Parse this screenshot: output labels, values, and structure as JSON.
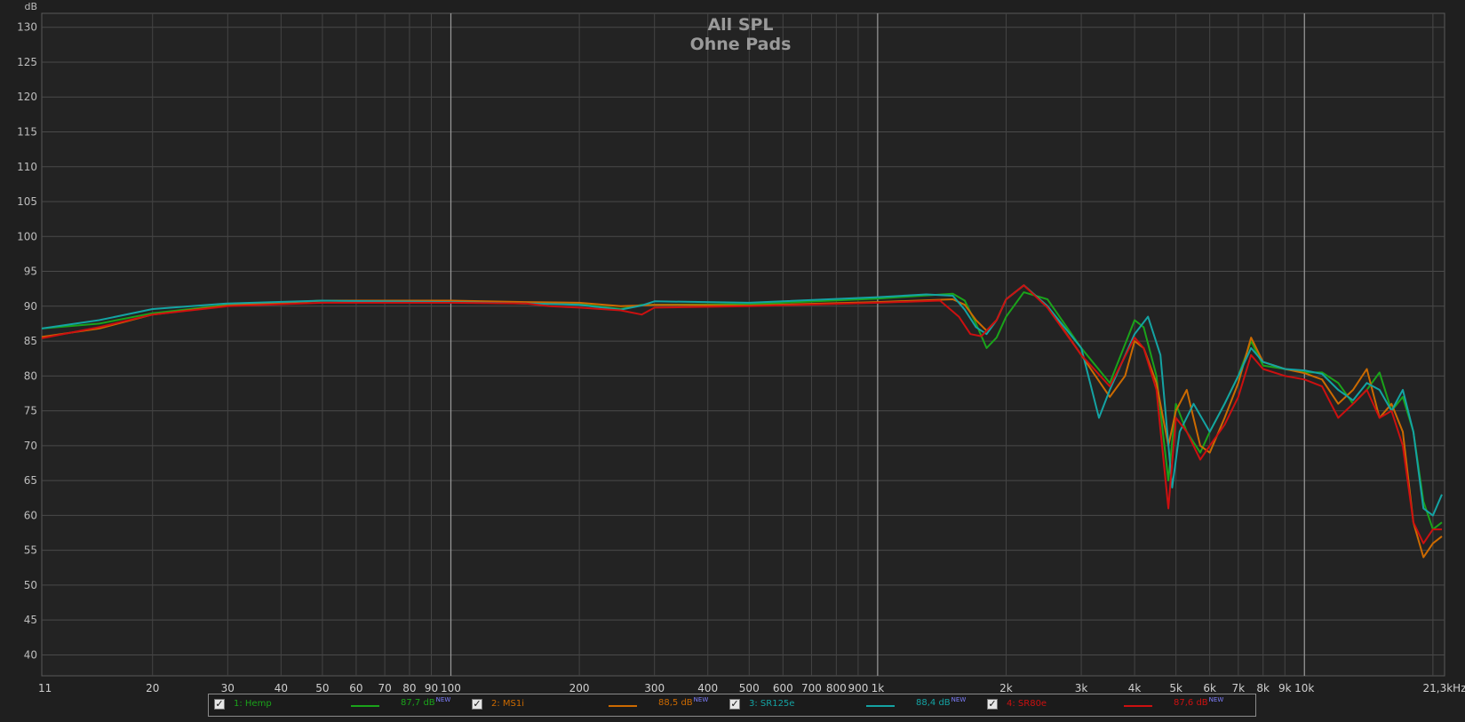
{
  "chart_data": {
    "type": "line",
    "title": "All SPL",
    "subtitle": "Ohne Pads",
    "ylabel": "dB",
    "xscale": "log",
    "xlim": [
      11,
      21300
    ],
    "ylim": [
      37,
      132
    ],
    "grid": true,
    "y_ticks": [
      130,
      125,
      120,
      115,
      110,
      105,
      100,
      95,
      90,
      85,
      80,
      75,
      70,
      65,
      60,
      55,
      50,
      45,
      40
    ],
    "x_ticks": [
      {
        "v": 11,
        "label": "11"
      },
      {
        "v": 20,
        "label": "20"
      },
      {
        "v": 30,
        "label": "30"
      },
      {
        "v": 40,
        "label": "40"
      },
      {
        "v": 50,
        "label": "50"
      },
      {
        "v": 60,
        "label": "60"
      },
      {
        "v": 70,
        "label": "70"
      },
      {
        "v": 80,
        "label": "80"
      },
      {
        "v": 90,
        "label": "90"
      },
      {
        "v": 100,
        "label": "100"
      },
      {
        "v": 200,
        "label": "200"
      },
      {
        "v": 300,
        "label": "300"
      },
      {
        "v": 400,
        "label": "400"
      },
      {
        "v": 500,
        "label": "500"
      },
      {
        "v": 600,
        "label": "600"
      },
      {
        "v": 700,
        "label": "700"
      },
      {
        "v": 800,
        "label": "800"
      },
      {
        "v": 900,
        "label": "900"
      },
      {
        "v": 1000,
        "label": "1k"
      },
      {
        "v": 2000,
        "label": "2k"
      },
      {
        "v": 3000,
        "label": "3k"
      },
      {
        "v": 4000,
        "label": "4k"
      },
      {
        "v": 5000,
        "label": "5k"
      },
      {
        "v": 6000,
        "label": "6k"
      },
      {
        "v": 7000,
        "label": "7k"
      },
      {
        "v": 8000,
        "label": "8k"
      },
      {
        "v": 9000,
        "label": "9k"
      },
      {
        "v": 10000,
        "label": "10k"
      },
      {
        "v": 21300,
        "label": "21,3kHz"
      }
    ],
    "major_x_lines": [
      100,
      1000,
      10000
    ],
    "series": [
      {
        "name": "1: Hemp",
        "color": "#1aa31a",
        "level": "87,7 dB",
        "x": [
          11,
          15,
          20,
          30,
          50,
          100,
          150,
          200,
          250,
          280,
          300,
          500,
          1000,
          1500,
          1600,
          1700,
          1800,
          1900,
          2000,
          2200,
          2500,
          3000,
          3500,
          4000,
          4200,
          4500,
          4800,
          5000,
          5300,
          5700,
          6000,
          6500,
          7000,
          7500,
          8000,
          9000,
          10000,
          11000,
          12000,
          13000,
          14000,
          15000,
          16000,
          17000,
          18000,
          19000,
          20000,
          21000
        ],
        "y": [
          86.8,
          87.5,
          89,
          90.2,
          90.8,
          90.6,
          90.4,
          90.3,
          89.6,
          90.2,
          90.2,
          90.3,
          91.1,
          91.8,
          90.8,
          87.5,
          84,
          85.5,
          88.5,
          92,
          91,
          84,
          79,
          88,
          87,
          80,
          65,
          76,
          72,
          69,
          72,
          76,
          80,
          85,
          81.5,
          81,
          80.5,
          80.5,
          79,
          76,
          78,
          80.5,
          75,
          77,
          72,
          62,
          58,
          59
        ]
      },
      {
        "name": "2: MS1i",
        "color": "#cc6a00",
        "level": "88,5 dB",
        "x": [
          11,
          15,
          20,
          30,
          50,
          100,
          150,
          200,
          250,
          280,
          300,
          500,
          1000,
          1500,
          1600,
          1700,
          1800,
          1900,
          2000,
          2200,
          2500,
          3000,
          3500,
          3800,
          4000,
          4200,
          4500,
          4800,
          5000,
          5300,
          5700,
          6000,
          6500,
          7000,
          7500,
          8000,
          9000,
          10000,
          11000,
          12000,
          13000,
          14000,
          15000,
          16000,
          17000,
          18000,
          19000,
          20000,
          21000
        ],
        "y": [
          85.6,
          86.8,
          88.8,
          90.1,
          90.8,
          90.8,
          90.6,
          90.5,
          90,
          90.1,
          90.2,
          90.1,
          90.6,
          91,
          90.2,
          88,
          86.5,
          88,
          91,
          93,
          90,
          83,
          77,
          80,
          85,
          84,
          79,
          70,
          75,
          78,
          70,
          69,
          74,
          79,
          85.5,
          82,
          81,
          80.4,
          79.5,
          76,
          78,
          81,
          74,
          76,
          72,
          59,
          54,
          56,
          57
        ]
      },
      {
        "name": "3: SR125e",
        "color": "#14a3a3",
        "level": "88,4 dB",
        "x": [
          11,
          15,
          20,
          30,
          50,
          100,
          150,
          200,
          250,
          280,
          300,
          500,
          1000,
          1300,
          1500,
          1600,
          1700,
          1800,
          1900,
          2000,
          2200,
          2500,
          3000,
          3300,
          3500,
          4000,
          4300,
          4600,
          4900,
          5100,
          5500,
          6000,
          6500,
          7000,
          7500,
          8000,
          9000,
          10000,
          11000,
          12000,
          13000,
          14000,
          15000,
          16000,
          17000,
          18000,
          19000,
          20000,
          21000
        ],
        "y": [
          86.8,
          88,
          89.6,
          90.4,
          90.8,
          90.6,
          90.4,
          90.2,
          89.5,
          90.1,
          90.7,
          90.5,
          91.3,
          91.7,
          91.5,
          89.5,
          87,
          86,
          88,
          91,
          93,
          90,
          84,
          74,
          78,
          86,
          88.5,
          83,
          64,
          72,
          76,
          72,
          76,
          80,
          84,
          82,
          81,
          80.8,
          80.3,
          78,
          76.5,
          79,
          78,
          75,
          78,
          72,
          61,
          60,
          63
        ]
      },
      {
        "name": "4: SR80e",
        "color": "#cc1010",
        "level": "87,6 dB",
        "x": [
          11,
          15,
          20,
          30,
          50,
          100,
          150,
          170,
          200,
          250,
          280,
          300,
          500,
          1000,
          1400,
          1550,
          1650,
          1750,
          1900,
          2000,
          2200,
          2500,
          3000,
          3500,
          4000,
          4200,
          4500,
          4800,
          5000,
          5300,
          5700,
          6000,
          6500,
          7000,
          7500,
          8000,
          9000,
          10000,
          11000,
          12000,
          13000,
          14000,
          15000,
          16000,
          17000,
          18000,
          19000,
          20000,
          21000
        ],
        "y": [
          85.4,
          87,
          88.8,
          90,
          90.5,
          90.5,
          90.4,
          90,
          89.8,
          89.4,
          88.8,
          89.8,
          90,
          90.5,
          90.8,
          88.5,
          86,
          85.7,
          88,
          91,
          93,
          89.8,
          83,
          78.5,
          85.5,
          84,
          78,
          61,
          74,
          72,
          68,
          70,
          73,
          77,
          83,
          81,
          80,
          79.5,
          78.5,
          74,
          76,
          78,
          74,
          75,
          70,
          59,
          56,
          58,
          58
        ]
      }
    ]
  },
  "legend": {
    "checkmark": "✓",
    "new_badge": "NEW"
  }
}
